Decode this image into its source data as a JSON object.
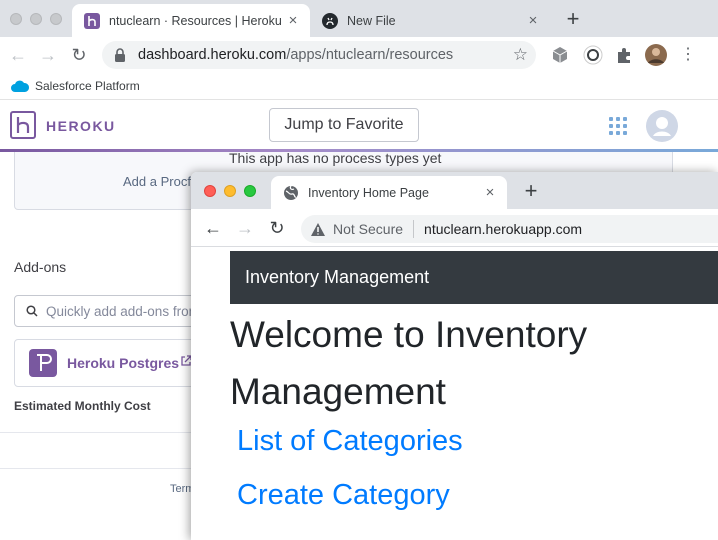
{
  "back_window": {
    "tabs": [
      {
        "title": "ntuclearn · Resources | Heroku",
        "close": "×",
        "active": true
      },
      {
        "title": "New File",
        "close": "×",
        "active": false
      }
    ],
    "new_tab": "+",
    "nav": {
      "back": "←",
      "forward": "→",
      "reload": "↻"
    },
    "address": {
      "host": "dashboard.heroku.com",
      "path": "/apps/ntuclearn/resources",
      "bookmark_star": "☆"
    },
    "menu": "⋮",
    "bookmark_bar": {
      "item": "Salesforce Platform"
    },
    "header": {
      "brand": "HEROKU",
      "jump_button": "Jump to Favorite"
    },
    "resources": {
      "process_message": "This app has no process types yet",
      "add_procfile": "Add a Procfile",
      "addons_title": "Add-ons",
      "addon_search_placeholder": "Quickly add add-ons from",
      "addon_name": "Heroku Postgres",
      "estimated_cost_label": "Estimated Monthly Cost",
      "footer_terms": "Terms"
    },
    "colors": {
      "brand": "#79589f",
      "accent": "#79a9d9"
    }
  },
  "front_window": {
    "tab": {
      "title": "Inventory Home Page",
      "close": "×"
    },
    "new_tab": "+",
    "nav": {
      "back": "←",
      "forward": "→",
      "reload": "↻"
    },
    "address": {
      "security": "Not Secure",
      "host": "ntuclearn.herokuapp.com"
    },
    "page": {
      "navbar_brand": "Inventory Management",
      "heading": "Welcome to Inventory Management",
      "links": [
        "List of Categories",
        "Create Category"
      ]
    },
    "colors": {
      "navbar": "#343a40",
      "link": "#007bff"
    }
  }
}
